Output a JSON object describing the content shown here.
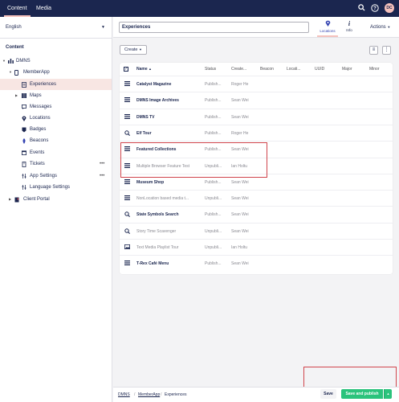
{
  "topbar": {
    "tabs": [
      "Content",
      "Media"
    ],
    "search_icon": "search-icon",
    "help_icon": "help-icon",
    "avatar_initials": "DC"
  },
  "sidebar": {
    "language": "English",
    "section_title": "Content",
    "tree": [
      {
        "label": "DMNS",
        "icon": "sitemap-icon"
      },
      {
        "label": "MemberApp",
        "icon": "mobile-icon"
      },
      {
        "label": "Experiences",
        "icon": "document-icon"
      },
      {
        "label": "Maps",
        "icon": "map-icon"
      },
      {
        "label": "Messages",
        "icon": "message-icon"
      },
      {
        "label": "Locations",
        "icon": "location-icon"
      },
      {
        "label": "Badges",
        "icon": "badge-icon"
      },
      {
        "label": "Beacons",
        "icon": "beacon-icon"
      },
      {
        "label": "Events",
        "icon": "calendar-icon"
      },
      {
        "label": "Tickets",
        "icon": "ticket-icon"
      },
      {
        "label": "App Settings",
        "icon": "settings-icon"
      },
      {
        "label": "Language Settings",
        "icon": "settings-icon"
      },
      {
        "label": "Client Portal",
        "icon": "book-icon"
      }
    ]
  },
  "header": {
    "node_name": "Experiences",
    "apps": [
      {
        "label": "Locations",
        "icon": "location-icon"
      },
      {
        "label": "Info",
        "icon": "info-icon"
      }
    ],
    "actions_label": "Actions"
  },
  "toolbar": {
    "create_label": "Create"
  },
  "table": {
    "columns": [
      "Name",
      "Status",
      "Create...",
      "Beacon",
      "Locati...",
      "UUID",
      "Major",
      "Minor"
    ],
    "rows": [
      {
        "name": "Catalyst Magazine",
        "status": "Publish...",
        "by": "Roger He",
        "published": true,
        "icon": "list-icon"
      },
      {
        "name": "DMNS Image Archives",
        "status": "Publish...",
        "by": "Sean Wei",
        "published": true,
        "icon": "list-icon"
      },
      {
        "name": "DMNS TV",
        "status": "Publish...",
        "by": "Sean Wei",
        "published": true,
        "icon": "list-icon"
      },
      {
        "name": "Elf Tour",
        "status": "Publish...",
        "by": "Roger He",
        "published": true,
        "icon": "zoom-icon"
      },
      {
        "name": "Featured Collections",
        "status": "Publish...",
        "by": "Sean Wei",
        "published": true,
        "icon": "list-icon"
      },
      {
        "name": "Multiple Browser Feature Test",
        "status": "Unpubli...",
        "by": "Ian Holtu",
        "published": false,
        "icon": "list-icon"
      },
      {
        "name": "Museum Shop",
        "status": "Publish...",
        "by": "Sean Wei",
        "published": true,
        "icon": "list-icon"
      },
      {
        "name": "NonLocation based media t...",
        "status": "Unpubli...",
        "by": "Sean Wei",
        "published": false,
        "icon": "list-icon"
      },
      {
        "name": "State Symbols Search",
        "status": "Publish...",
        "by": "Sean Wei",
        "published": true,
        "icon": "zoom-icon"
      },
      {
        "name": "Story Time Scavenger",
        "status": "Unpubli...",
        "by": "Sean Wei",
        "published": false,
        "icon": "zoom-icon"
      },
      {
        "name": "Text Media Playlist Tour",
        "status": "Unpubli...",
        "by": "Ian Holtu",
        "published": false,
        "icon": "image-icon"
      },
      {
        "name": "T-Rex Café Menu",
        "status": "Publish...",
        "by": "Sean Wei",
        "published": true,
        "icon": "list-icon"
      }
    ]
  },
  "footer": {
    "breadcrumb": [
      "DMNS",
      "MemberApp",
      "Experiences"
    ],
    "save_label": "Save",
    "publish_label": "Save and publish"
  },
  "colors": {
    "brand": "#1b264f",
    "accent": "#f5c1bc",
    "success": "#2bc37c",
    "highlight": "#d0454c"
  }
}
